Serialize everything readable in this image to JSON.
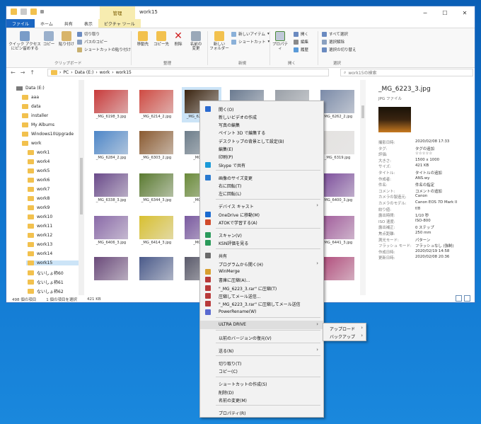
{
  "window": {
    "title": "work15",
    "context_tab": "管理",
    "minimize": "─",
    "maximize": "☐",
    "close": "✕"
  },
  "tabs": [
    {
      "label": "ファイル"
    },
    {
      "label": "ホーム"
    },
    {
      "label": "共有"
    },
    {
      "label": "表示"
    },
    {
      "label": "ピクチャ ツール"
    }
  ],
  "ribbon": {
    "clipboard": {
      "quick_access": "クイック アクセス\nにピン留めする",
      "copy": "コピー",
      "paste": "貼り付け",
      "cut": "切り取り",
      "copy_path": "パスのコピー",
      "paste_shortcut": "ショートカットの貼り付け",
      "group": "クリップボード"
    },
    "organize": {
      "move_to": "移動先",
      "copy_to": "コピー先",
      "delete": "削除",
      "rename": "名前の\n変更",
      "group": "整理"
    },
    "new": {
      "new_folder": "新しい\nフォルダー",
      "new_item": "新しいアイテム",
      "shortcut": "ショートカット",
      "group": "新規"
    },
    "open": {
      "properties": "プロパティ",
      "open": "開く",
      "edit": "編集",
      "history": "履歴",
      "group": "開く"
    },
    "select": {
      "select_all": "すべて選択",
      "select_none": "選択解除",
      "invert": "選択の切り替え",
      "group": "選択"
    }
  },
  "address": {
    "back": "←",
    "forward": "→",
    "up": "↑",
    "crumbs": [
      "PC",
      "Data (E:)",
      "work",
      "work15"
    ],
    "search_placeholder": "work15の検索"
  },
  "nav": {
    "items": [
      {
        "label": "Data (E:)"
      },
      {
        "label": "aaa"
      },
      {
        "label": "data"
      },
      {
        "label": "installer"
      },
      {
        "label": "My Albums"
      },
      {
        "label": "Windows10Upgrade"
      },
      {
        "label": "work"
      },
      {
        "label": "work1"
      },
      {
        "label": "work4"
      },
      {
        "label": "work5"
      },
      {
        "label": "work6"
      },
      {
        "label": "work7"
      },
      {
        "label": "work8"
      },
      {
        "label": "work9"
      },
      {
        "label": "work10"
      },
      {
        "label": "work11"
      },
      {
        "label": "work12"
      },
      {
        "label": "work13"
      },
      {
        "label": "work14"
      },
      {
        "label": "work15"
      },
      {
        "label": "ないしょ柿60"
      },
      {
        "label": "ないしょ柿61"
      },
      {
        "label": "ないしょ柿62"
      }
    ]
  },
  "thumbs": [
    {
      "name": "_MG_6198_3.jpg",
      "color": "#c83a3a"
    },
    {
      "name": "_MG_6214_2.jpg",
      "color": "#cf4a42"
    },
    {
      "name": "_MG_6223_3.jpg",
      "color": "#3a2410"
    },
    {
      "name": "",
      "color": "#6a7a90"
    },
    {
      "name": "",
      "color": "#9aa0a8"
    },
    {
      "name": "_MG_6262_2.jpg",
      "color": "#7a8aa8"
    },
    {
      "name": "_MG_6284_2.jpg",
      "color": "#4d86c8"
    },
    {
      "name": "_MG_6303_2.jpg",
      "color": "#8a5a30"
    },
    {
      "name": "_MG_631",
      "color": "#6d7d8a"
    },
    {
      "name": "",
      "color": "#dcdcdc"
    },
    {
      "name": "",
      "color": "#e8e8e8"
    },
    {
      "name": "_MG_6319.jpg",
      "color": "#e4e2e0"
    },
    {
      "name": "_MG_6338_3.jpg",
      "color": "#6a4a8a"
    },
    {
      "name": "_MG_6344_3.jpg",
      "color": "#5a7a30"
    },
    {
      "name": "_MG_634",
      "color": "#6a8a3a"
    },
    {
      "name": "",
      "color": "#8a6aa8"
    },
    {
      "name": "",
      "color": "#7a5a9a"
    },
    {
      "name": "_MG_6400_3.jpg",
      "color": "#7a4a9a"
    },
    {
      "name": "_MG_6406_3.jpg",
      "color": "#8a6aa8"
    },
    {
      "name": "_MG_6414_3.jpg",
      "color": "#d8c030"
    },
    {
      "name": "_MG_642",
      "color": "#7a5aa0"
    },
    {
      "name": "",
      "color": "#8a7ab0"
    },
    {
      "name": "",
      "color": "#9a6aa0"
    },
    {
      "name": "_MG_6441_3.jpg",
      "color": "#a05a9a"
    },
    {
      "name": "",
      "color": "#6a4a7a"
    },
    {
      "name": "",
      "color": "#4a5a8a"
    },
    {
      "name": "",
      "color": "#5a5a6a"
    },
    {
      "name": "",
      "color": "#7a6a8a"
    },
    {
      "name": "",
      "color": "#8a7a9a"
    },
    {
      "name": "",
      "color": "#b04a7a"
    }
  ],
  "details": {
    "title": "_MG_6223_3.jpg",
    "type": "JPG ファイル",
    "thumb_color": "#3a2410",
    "rows": [
      {
        "k": "撮影日時:",
        "v": "2020/02/08 17:33"
      },
      {
        "k": "タグ:",
        "v": "タグの追加"
      },
      {
        "k": "評価:",
        "v": "☆☆☆☆☆"
      },
      {
        "k": "大きさ:",
        "v": "1500 x 1000"
      },
      {
        "k": "サイズ:",
        "v": "421 KB"
      },
      {
        "k": "タイトル:",
        "v": "タイトルの追加"
      },
      {
        "k": "作成者:",
        "v": "ANS.wy"
      },
      {
        "k": "件名:",
        "v": "件名の指定"
      },
      {
        "k": "コメント:",
        "v": "コメントの追加"
      },
      {
        "k": "カメラの製造元:",
        "v": "Canon"
      },
      {
        "k": "カメラのモデル:",
        "v": "Canon EOS 7D Mark II"
      },
      {
        "k": "絞り値:",
        "v": "f/8"
      },
      {
        "k": "露出時間:",
        "v": "1/10 秒"
      },
      {
        "k": "ISO 速度:",
        "v": "ISO-800"
      },
      {
        "k": "露出補正:",
        "v": "0 ステップ"
      },
      {
        "k": "焦点距離:",
        "v": "250 mm"
      },
      {
        "k": "測光モード:",
        "v": "パターン"
      },
      {
        "k": "フラッシュ モード:",
        "v": "フラッシュなし (強制)"
      },
      {
        "k": "作成日時:",
        "v": "2020/02/19 14:58"
      },
      {
        "k": "更新日時:",
        "v": "2020/02/08 20:36"
      }
    ]
  },
  "status": {
    "count": "498 個の項目",
    "selected": "1 個の項目を選択",
    "size": "421 KB"
  },
  "context_menu": {
    "items": [
      {
        "label": "開く(O)"
      },
      {
        "label": "新しいビデオの作成"
      },
      {
        "label": "写真の編集"
      },
      {
        "label": "ペイント 3D で編集する"
      },
      {
        "label": "デスクトップの背景として設定(B)"
      },
      {
        "label": "編集(E)"
      },
      {
        "label": "印刷(P)"
      },
      {
        "label": "Skype で共有"
      },
      {
        "label": "画像のサイズ変更"
      },
      {
        "label": "右に回転(T)"
      },
      {
        "label": "左に回転(L)"
      },
      {
        "label": "デバイス キャスト"
      },
      {
        "label": "OneDrive に移動(M)"
      },
      {
        "label": "ATOKで学習する(A)"
      },
      {
        "label": "スキャン(V)"
      },
      {
        "label": "KSN評価を見る"
      },
      {
        "label": "共有"
      },
      {
        "label": "プログラムから開く(H)"
      },
      {
        "label": "WinMerge"
      },
      {
        "label": "書庫に圧縮(A)..."
      },
      {
        "label": "\"_MG_6223_3.rar\" に圧縮(T)"
      },
      {
        "label": "圧縮してメール送信..."
      },
      {
        "label": "\"_MG_6223_3.rar\" に圧縮してメール送信"
      },
      {
        "label": "PowerRename(W)"
      },
      {
        "label": "ULTRA DRIVE"
      },
      {
        "label": "以前のバージョンの復元(V)"
      },
      {
        "label": "送る(N)"
      },
      {
        "label": "切り取り(T)"
      },
      {
        "label": "コピー(C)"
      },
      {
        "label": "ショートカットの作成(S)"
      },
      {
        "label": "削除(D)"
      },
      {
        "label": "名前の変更(M)"
      },
      {
        "label": "プロパティ(R)"
      }
    ],
    "submenu": [
      {
        "label": "アップロード"
      },
      {
        "label": "バックアップ"
      }
    ]
  }
}
